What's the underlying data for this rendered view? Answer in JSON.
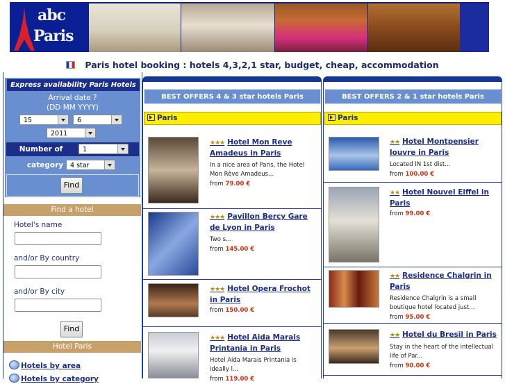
{
  "banner": {
    "logo_line1": "abc",
    "logo_line2": "Paris"
  },
  "header": {
    "title": "Paris hotel booking : hotels 4,3,2,1 star, budget, cheap, accommodation"
  },
  "availability": {
    "heading": "Express availability Paris Hotels",
    "arrival_label": "Arrival date ?",
    "arrival_format": "(DD MM YYYY)",
    "day": "15",
    "month": "6",
    "year": "2011",
    "nights_label": "Number of nights",
    "nights": "1",
    "category_label": "category",
    "category": "4 star",
    "find_label": "Find"
  },
  "find_hotel": {
    "heading": "Find a hotel",
    "name_label": "Hotel's name",
    "country_label": "and/or By country",
    "city_label": "and/or By city",
    "find_label": "Find"
  },
  "hotel_paris": {
    "heading": "Hotel Paris",
    "links": [
      "Hotels by area",
      "Hotels by category"
    ]
  },
  "columns": {
    "left": {
      "heading": "BEST OFFERS 4 & 3 star hotels Paris",
      "city": "Paris",
      "hotels": [
        {
          "stars": "★★★",
          "name": "Hotel Mon Reve Amadeus in Paris",
          "desc": "In a nice area of Paris, the Hotel Mon Rêve Amadeus...",
          "price_prefix": "from",
          "price": "79.00 €"
        },
        {
          "stars": "★★★",
          "name": "Pavillon Bercy Gare de Lyon in Paris",
          "desc": "Two s...",
          "price_prefix": "from",
          "price": "145.00 €"
        },
        {
          "stars": "★★★",
          "name": "Hotel Opera Frochot in Paris",
          "desc": "",
          "price_prefix": "from",
          "price": "150.00 €"
        },
        {
          "stars": "★★★",
          "name": "Hotel Aida Marais Printania in Paris",
          "desc": "Hotel Aida Marais Printania is ideally l...",
          "price_prefix": "from",
          "price": "119.00 €"
        }
      ]
    },
    "right": {
      "heading": "BEST OFFERS 2 & 1 star hotels Paris",
      "city": "Paris",
      "hotels": [
        {
          "stars": "★★",
          "name": "Hotel Montpensier louvre in Paris",
          "desc": "Located IN 1st dist...",
          "price_prefix": "from",
          "price": "100.00 €"
        },
        {
          "stars": "★★",
          "name": "Hotel Nouvel Eiffel in Paris",
          "desc": "",
          "price_prefix": "from",
          "price": "99.00 €"
        },
        {
          "stars": "★★",
          "name": "Residence Chalgrin in Paris",
          "desc": "Residence Chalgrin is a small boutique hotel located just...",
          "price_prefix": "from",
          "price": "95.00 €"
        },
        {
          "stars": "★★",
          "name": "Hotel du Bresil in Paris",
          "desc": "Stay in the heart of the intellectual life of Par...",
          "price_prefix": "from",
          "price": "90.00 €"
        }
      ]
    }
  },
  "colors": {
    "navy": "#1c2e8c",
    "mid_blue": "#6a8fd0",
    "tan": "#c8a06a",
    "yellow": "#ffee00",
    "price_red": "#d03010"
  }
}
